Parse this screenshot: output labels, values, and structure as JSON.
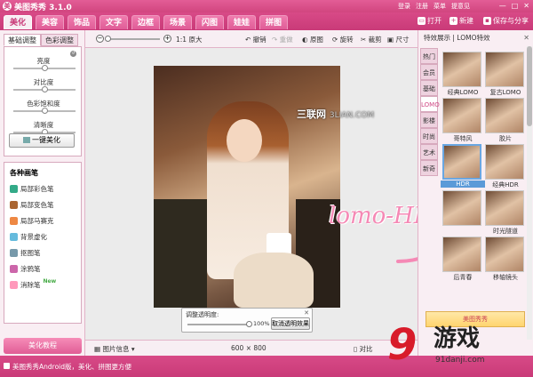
{
  "window": {
    "title": "美图秀秀 3.1.0",
    "top_links": [
      "登录",
      "注册",
      "菜单",
      "提意见"
    ],
    "controls": [
      "—",
      "□",
      "✕"
    ]
  },
  "main_tabs": [
    {
      "label": "美化",
      "active": true
    },
    {
      "label": "美容",
      "active": false
    },
    {
      "label": "饰品",
      "active": false
    },
    {
      "label": "文字",
      "active": false
    },
    {
      "label": "边框",
      "active": false
    },
    {
      "label": "场景",
      "active": false
    },
    {
      "label": "闪图",
      "active": false
    },
    {
      "label": "娃娃",
      "active": false
    },
    {
      "label": "拼图",
      "active": false
    }
  ],
  "top_actions": {
    "open": "打开",
    "new": "新建",
    "save": "保存与分享"
  },
  "left_panel": {
    "subtabs": [
      "基础调整",
      "色彩调整"
    ],
    "sliders": [
      {
        "label": "亮度",
        "value": 0.5
      },
      {
        "label": "对比度",
        "value": 0.5
      },
      {
        "label": "色彩饱和度",
        "value": 0.5
      },
      {
        "label": "清晰度",
        "value": 0.5
      }
    ],
    "one_key_button": "一键美化",
    "brushes_title": "各种画笔",
    "brushes": [
      "局部彩色笔",
      "局部变色笔",
      "局部马赛克",
      "背景虚化",
      "抠图笔",
      "涂鸦笔",
      "消除笔"
    ],
    "brush_new_badge": "New",
    "tutorial": "美化教程"
  },
  "toolbar": {
    "zoom_label": "1:1 原大",
    "undo": "撤销",
    "redo": "重做",
    "original": "原图",
    "rotate": "旋转",
    "crop": "裁剪",
    "size": "尺寸"
  },
  "canvas": {
    "watermark_site": "三联网",
    "watermark_domain": "3LIAN.COM",
    "handwriting": "lomo-HDR",
    "opacity_label": "调整透明度:",
    "opacity_value": "100%",
    "opacity_pct": 1.0,
    "cancel_transparency": "取消透明效果",
    "image_info": "图片信息",
    "dimensions": "600 × 800",
    "compare": "对比"
  },
  "right_panel": {
    "header": "特效展示 | LOMO特效",
    "categories": [
      {
        "label": "热门",
        "active": false
      },
      {
        "label": "会员",
        "active": false
      },
      {
        "label": "基础",
        "active": false
      },
      {
        "label": "LOMO",
        "active": true
      },
      {
        "label": "影楼",
        "active": false
      },
      {
        "label": "时尚",
        "active": false
      },
      {
        "label": "艺术",
        "active": false
      },
      {
        "label": "新奇",
        "active": false
      }
    ],
    "effects": [
      {
        "label": "经典LOMO",
        "selected": false
      },
      {
        "label": "复古LOMO",
        "selected": false
      },
      {
        "label": "哥特风",
        "selected": false
      },
      {
        "label": "胶片",
        "selected": false
      },
      {
        "label": "HDR",
        "selected": true
      },
      {
        "label": "经典HDR",
        "selected": false
      },
      {
        "label": "",
        "selected": false
      },
      {
        "label": "时光隧道",
        "selected": false
      },
      {
        "label": "后青春",
        "selected": false
      },
      {
        "label": "移轴镜头",
        "selected": false
      }
    ],
    "banner": "美图秀秀"
  },
  "status_bar": {
    "text": "美图秀秀Android版，美化、拼图更方便"
  },
  "logo": {
    "mark": "9",
    "name": "游戏",
    "domain": "91danji.com"
  },
  "colors": {
    "brand": "#d1457f",
    "selected": "#5b9ad8",
    "logo_red": "#d81b2a"
  }
}
